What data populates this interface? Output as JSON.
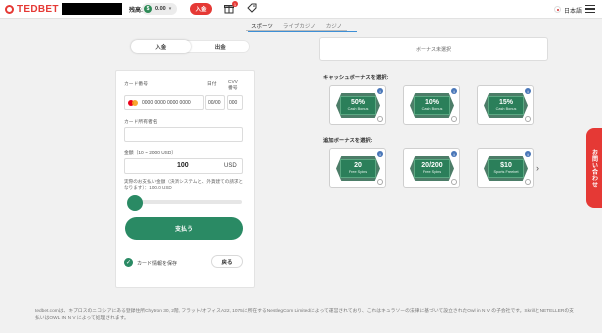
{
  "header": {
    "logo_text": "TEDBET",
    "balance_label": "残高:",
    "balance_coin": "$",
    "balance_value": "0.00",
    "balance_chevron": "▾",
    "deposit_label": "入金",
    "gift_badge": "1",
    "language": "日本語"
  },
  "subnav": {
    "tabs": [
      "スポーツ",
      "ライブカジノ",
      "カジノ"
    ]
  },
  "toggle": {
    "deposit": "入金",
    "withdraw": "出金"
  },
  "form": {
    "card_number_label": "カード番号",
    "expiry_label": "日付",
    "cvv_label": "CVV番号",
    "card_number_value": "0000 0000 0000 0000",
    "expiry_value": "00/00",
    "cvv_value": "000",
    "holder_label": "カード所有者名",
    "amount_label": "金額（10 ~ 2000 USD）",
    "amount_value": "100",
    "amount_currency": "USD",
    "actual_note": "実際のお支払い金額（決済システムと、外貨建ての請求となります）：100.0 USD",
    "slider_fraction": 0.05,
    "pay_label": "支払う",
    "save_card_label": "カード情報を保存",
    "back_label": "戻る"
  },
  "bonus": {
    "selector_placeholder": "ボーナス未選択",
    "cash_title": "キャッシュボーナスを選択:",
    "cash_items": [
      {
        "big": "50%",
        "small": "Cash Bonus"
      },
      {
        "big": "10%",
        "small": "Cash Bonus"
      },
      {
        "big": "15%",
        "small": "Cash Bonus"
      }
    ],
    "extra_title": "追加ボーナスを選択:",
    "extra_items": [
      {
        "big": "20",
        "small": "Free Spins"
      },
      {
        "big": "20/200",
        "small": "Free Spins"
      },
      {
        "big": "$10",
        "small": "Sports Freebet"
      }
    ],
    "next_arrow": "›"
  },
  "help_tab": "お問い合わせ",
  "footer": {
    "text": "tedbet.comは、キプロスのニコシアにある登録住所Chytron 30, 2階, フラット/オフィスA22, 1075に所在するNestlegCom Limitedによって運営されており、これはキュラソーの法律に基づいて設立されたOwl in N V の子会社です。SkrillとNETELLERの支払いはOWL IN N V によって処理されます。"
  },
  "colors": {
    "brand_red": "#e53935",
    "accent_green": "#2a8a64",
    "info_blue": "#4a77b8"
  }
}
